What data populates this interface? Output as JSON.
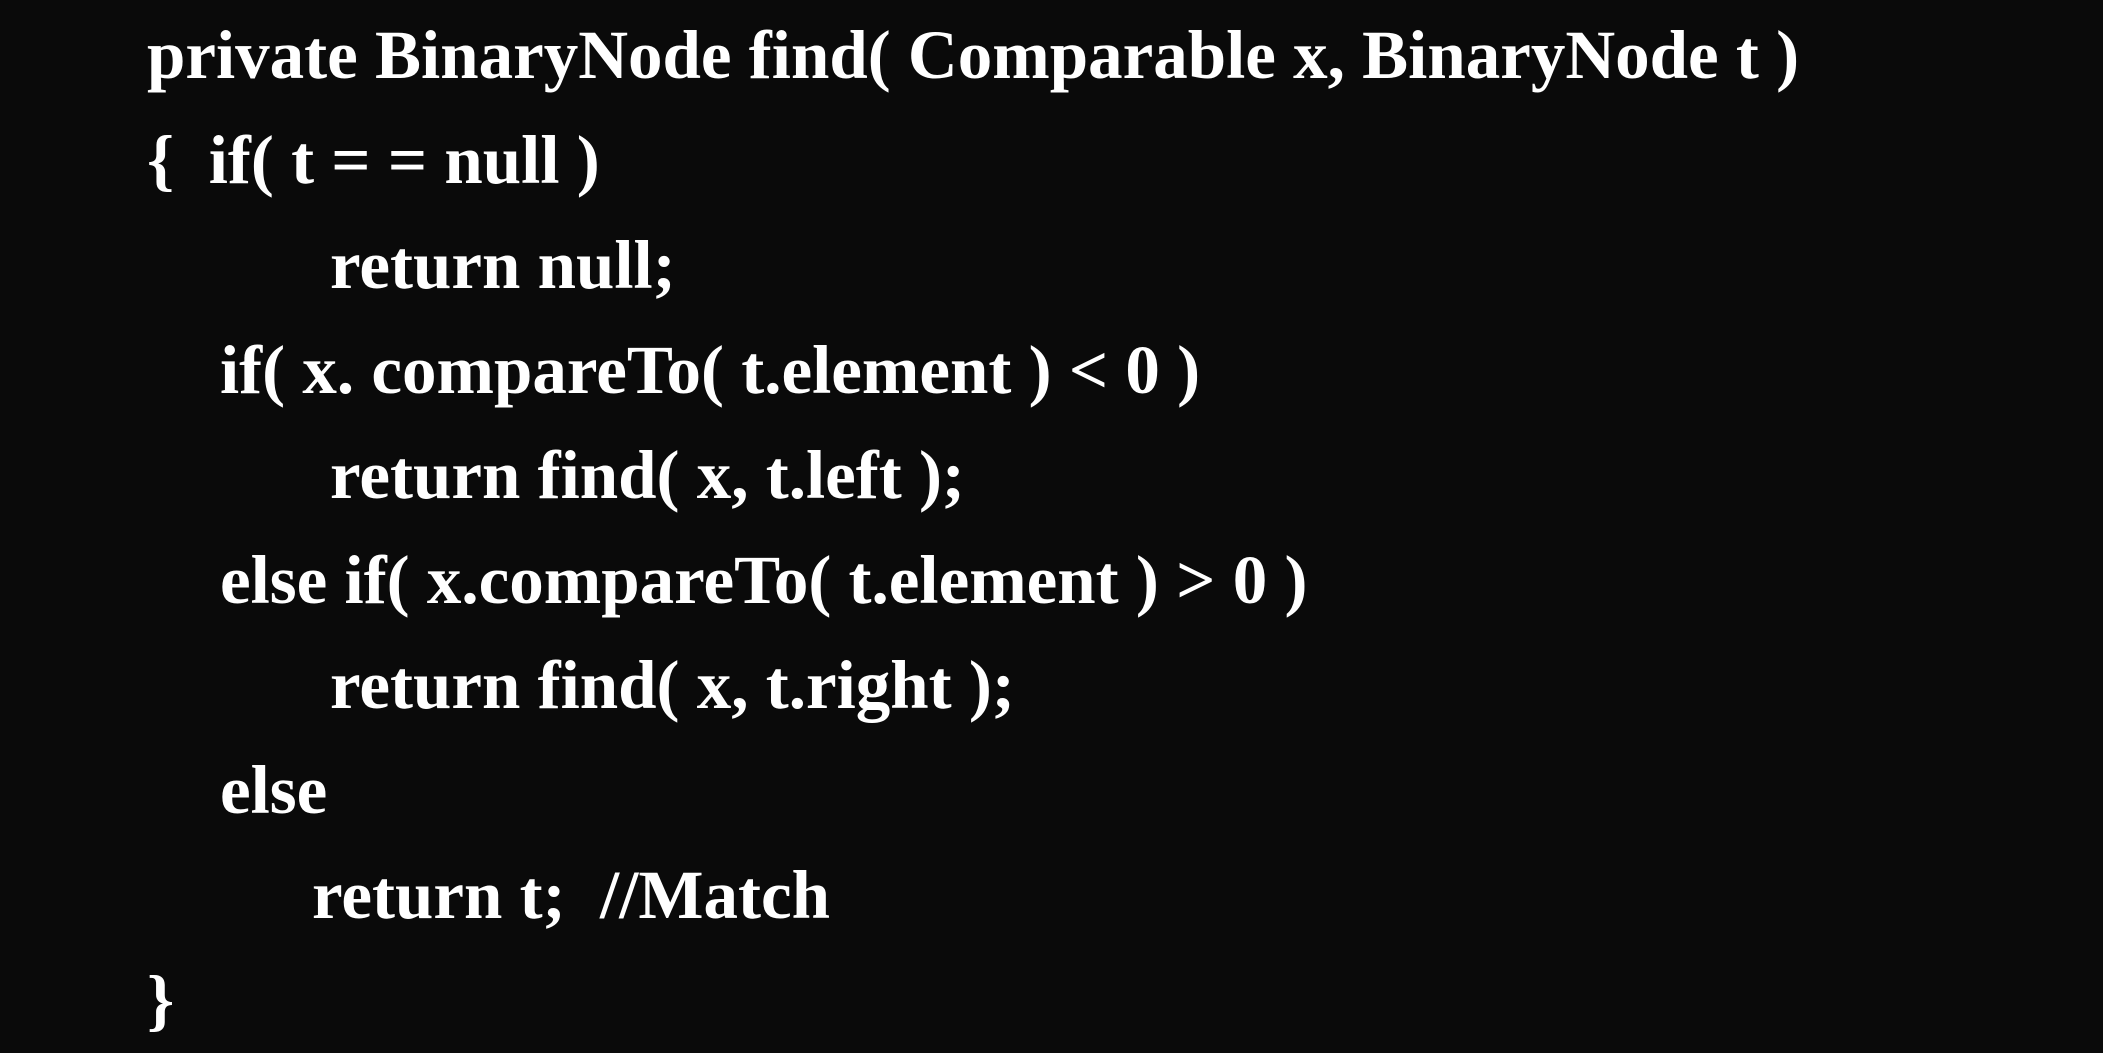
{
  "code": {
    "lines": [
      "private BinaryNode find( Comparable x, BinaryNode t )",
      "{  if( t = = null )",
      "return null;",
      "if( x. compareTo( t.element ) < 0 )",
      "return find( x, t.left );",
      "else if( x.compareTo( t.element ) > 0 )",
      "return find( x, t.right );",
      "else",
      "return t;  //Match",
      "}"
    ]
  },
  "colors": {
    "background": "#0a0a0a",
    "text": "#ffffff"
  }
}
